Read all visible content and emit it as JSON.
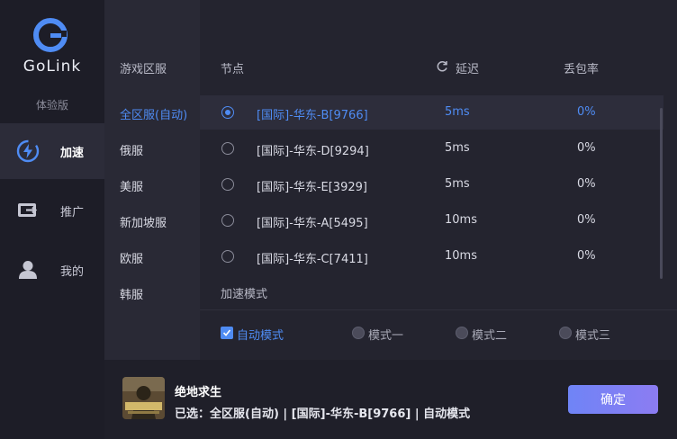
{
  "app": {
    "brand": "GoLink",
    "edition": "体验版"
  },
  "nav": [
    {
      "label": "加速",
      "icon": "lightning-icon",
      "active": true
    },
    {
      "label": "推广",
      "icon": "share-icon",
      "active": false
    },
    {
      "label": "我的",
      "icon": "user-icon",
      "active": false
    }
  ],
  "headers": {
    "region": "游戏区服",
    "node": "节点",
    "latency": "延迟",
    "loss": "丢包率"
  },
  "regions": [
    {
      "label": "全区服(自动)",
      "active": true
    },
    {
      "label": "俄服",
      "active": false
    },
    {
      "label": "美服",
      "active": false
    },
    {
      "label": "新加坡服",
      "active": false
    },
    {
      "label": "欧服",
      "active": false
    },
    {
      "label": "韩服",
      "active": false
    }
  ],
  "nodes": [
    {
      "name": "[国际]-华东-B[9766]",
      "latency": "5ms",
      "loss": "0%",
      "selected": true
    },
    {
      "name": "[国际]-华东-D[9294]",
      "latency": "5ms",
      "loss": "0%",
      "selected": false
    },
    {
      "name": "[国际]-华东-E[3929]",
      "latency": "5ms",
      "loss": "0%",
      "selected": false
    },
    {
      "name": "[国际]-华东-A[5495]",
      "latency": "10ms",
      "loss": "0%",
      "selected": false
    },
    {
      "name": "[国际]-华东-C[7411]",
      "latency": "10ms",
      "loss": "0%",
      "selected": false
    }
  ],
  "mode": {
    "title": "加速模式",
    "options": [
      {
        "label": "自动模式",
        "selected": true
      },
      {
        "label": "模式一",
        "selected": false
      },
      {
        "label": "模式二",
        "selected": false
      },
      {
        "label": "模式三",
        "selected": false
      }
    ]
  },
  "footer": {
    "game_name": "绝地求生",
    "selection": "已选：全区服(自动) | [国际]-华东-B[9766] | 自动模式",
    "confirm_label": "确定"
  },
  "colors": {
    "accent": "#4f8cf4",
    "sidebar": "#1d1d27",
    "background": "#24242f",
    "button_start": "#6f84f6",
    "button_end": "#8c7cf2"
  }
}
